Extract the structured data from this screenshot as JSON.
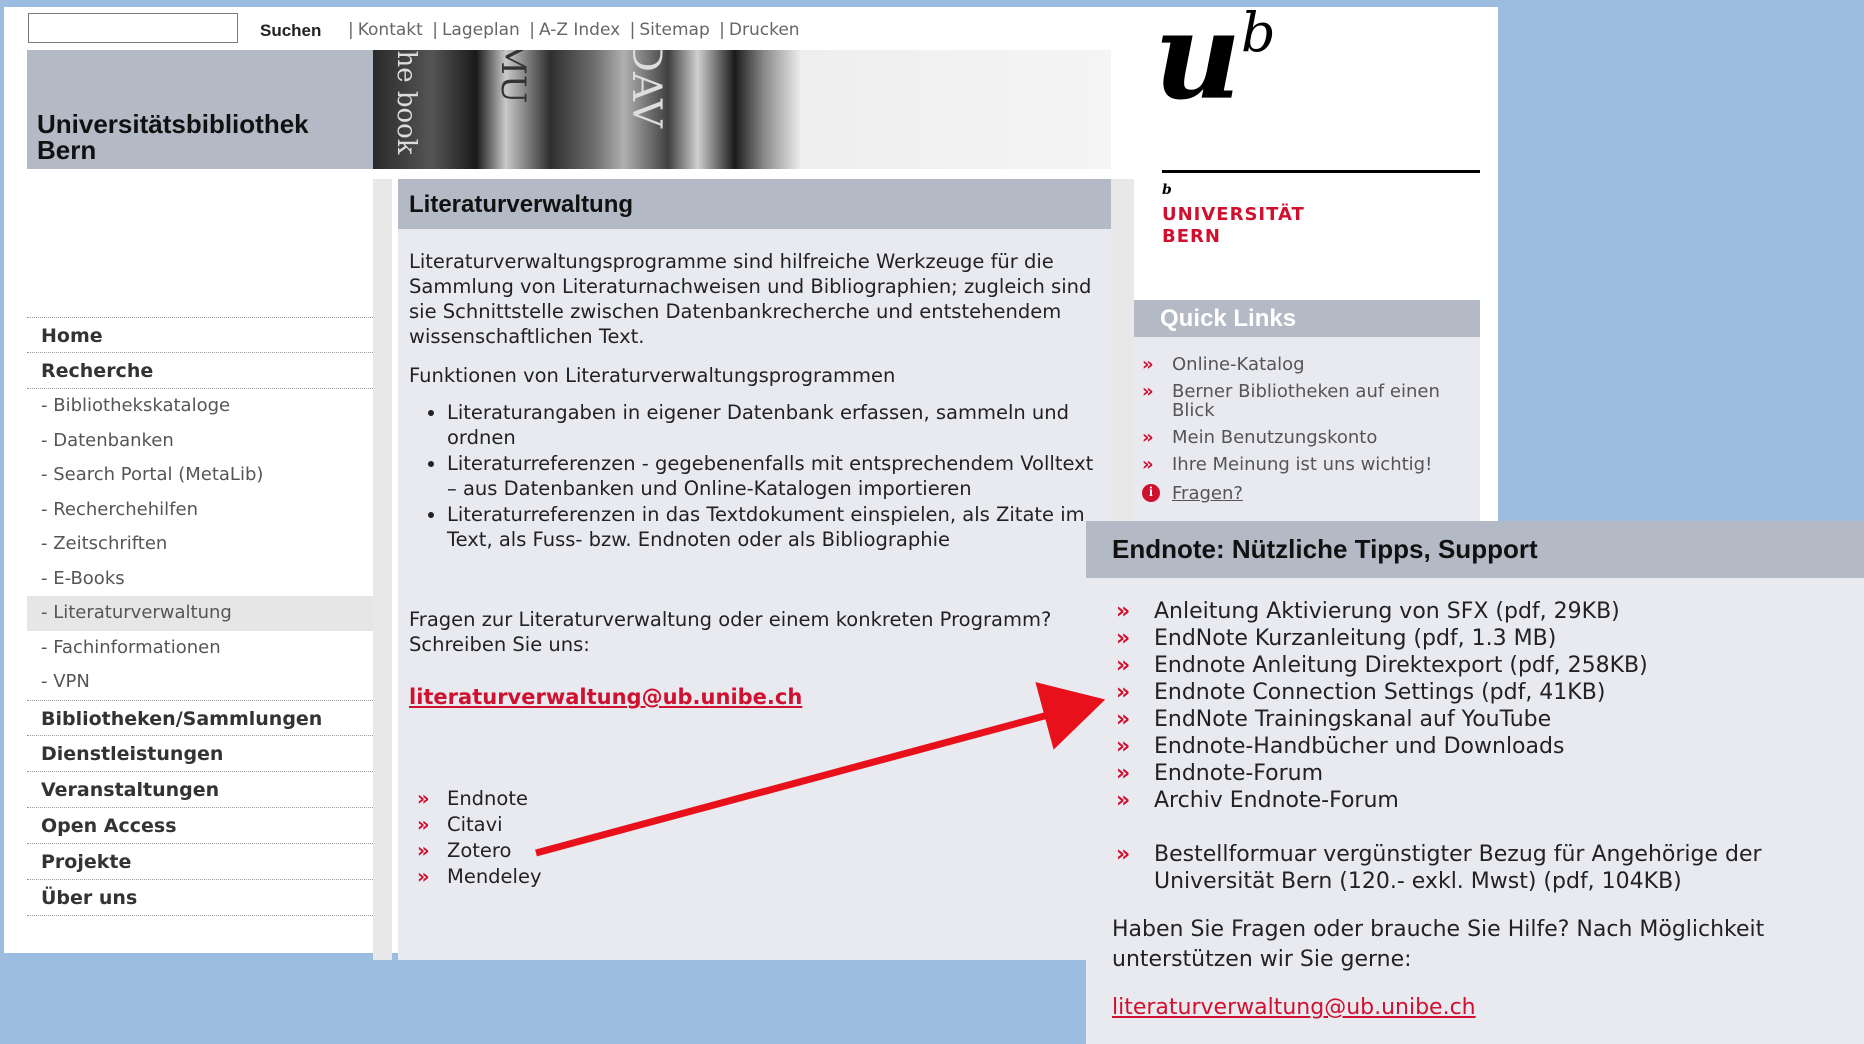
{
  "topbar": {
    "search_button": "Suchen",
    "links": [
      "Kontakt",
      "Lageplan",
      "A-Z Index",
      "Sitemap",
      "Drucken"
    ]
  },
  "header": {
    "title_line1": "Universitätsbibliothek",
    "title_line2": "Bern"
  },
  "logo": {
    "u": "u",
    "b": "b",
    "small_b": "b",
    "line1": "UNIVERSITÄT",
    "line2": "BERN"
  },
  "sidebar": {
    "items": [
      {
        "label": "Home",
        "type": "top"
      },
      {
        "label": "Recherche",
        "type": "top"
      },
      {
        "label": "- Bibliothekskataloge",
        "type": "sub"
      },
      {
        "label": "- Datenbanken",
        "type": "sub"
      },
      {
        "label": "- Search Portal (MetaLib)",
        "type": "sub"
      },
      {
        "label": "- Recherchehilfen",
        "type": "sub"
      },
      {
        "label": "- Zeitschriften",
        "type": "sub"
      },
      {
        "label": "- E-Books",
        "type": "sub"
      },
      {
        "label": "- Literaturverwaltung",
        "type": "sub",
        "active": true
      },
      {
        "label": "- Fachinformationen",
        "type": "sub"
      },
      {
        "label": "- VPN",
        "type": "sub"
      },
      {
        "label": "Bibliotheken/Sammlungen",
        "type": "top"
      },
      {
        "label": "Dienstleistungen",
        "type": "top"
      },
      {
        "label": "Veranstaltungen",
        "type": "top"
      },
      {
        "label": "Open Access",
        "type": "top"
      },
      {
        "label": "Projekte",
        "type": "top"
      },
      {
        "label": "Über uns",
        "type": "top"
      }
    ]
  },
  "main": {
    "title": "Literaturverwaltung",
    "intro": "Literaturverwaltungsprogramme sind hilfreiche Werkzeuge für die Sammlung von Literaturnachweisen und Bibliographien; zugleich sind sie Schnittstelle zwischen Datenbankrecherche und entstehendem wissenschaftlichen Text.",
    "functions_heading": "Funktionen von Literaturverwaltungsprogrammen",
    "functions": [
      "Literaturangaben in eigener Datenbank erfassen, sammeln und ordnen",
      "Literaturreferenzen - gegebenenfalls mit entsprechendem Volltext – aus Datenbanken und Online-Katalogen importieren",
      "Literaturreferenzen in das Textdokument einspielen, als Zitate im Text, als Fuss- bzw. Endnoten oder als Bibliographie"
    ],
    "contact_text": "Fragen zur Literaturverwaltung oder einem konkreten Programm? Schreiben Sie uns:",
    "email": "literaturverwaltung@ub.unibe.ch",
    "programs": [
      "Endnote",
      "Citavi",
      "Zotero",
      "Mendeley"
    ],
    "bullet": "»"
  },
  "quicklinks": {
    "title": "Quick Links",
    "items": [
      "Online-Katalog",
      "Berner Bibliotheken auf einen Blick",
      "Mein Benutzungskonto",
      "Ihre Meinung ist uns wichtig!"
    ],
    "fragen": "Fragen?",
    "info_glyph": "i"
  },
  "popup": {
    "title": "Endnote: Nützliche Tipps, Support",
    "items": [
      "Anleitung Aktivierung von SFX (pdf, 29KB)",
      "EndNote Kurzanleitung (pdf, 1.3 MB)",
      "Endnote Anleitung Direktexport (pdf, 258KB)",
      "Endnote Connection Settings (pdf, 41KB)",
      "EndNote Trainingskanal auf YouTube",
      "Endnote-Handbücher und Downloads",
      "Endnote-Forum",
      "Archiv Endnote-Forum"
    ],
    "order_item": "Bestellformuar vergünstigter Bezug für Angehörige der Universität Bern (120.- exkl. Mwst) (pdf, 104KB)",
    "help_text": "Haben Sie Fragen oder brauche Sie Hilfe? Nach Möglichkeit unterstützen wir Sie gerne:",
    "email": "literaturverwaltung@ub.unibe.ch"
  },
  "colors": {
    "background": "#9dbde0",
    "header_grey": "#b4bac5",
    "content_bg": "#e9eaf0",
    "accent_red": "#d0102f"
  }
}
